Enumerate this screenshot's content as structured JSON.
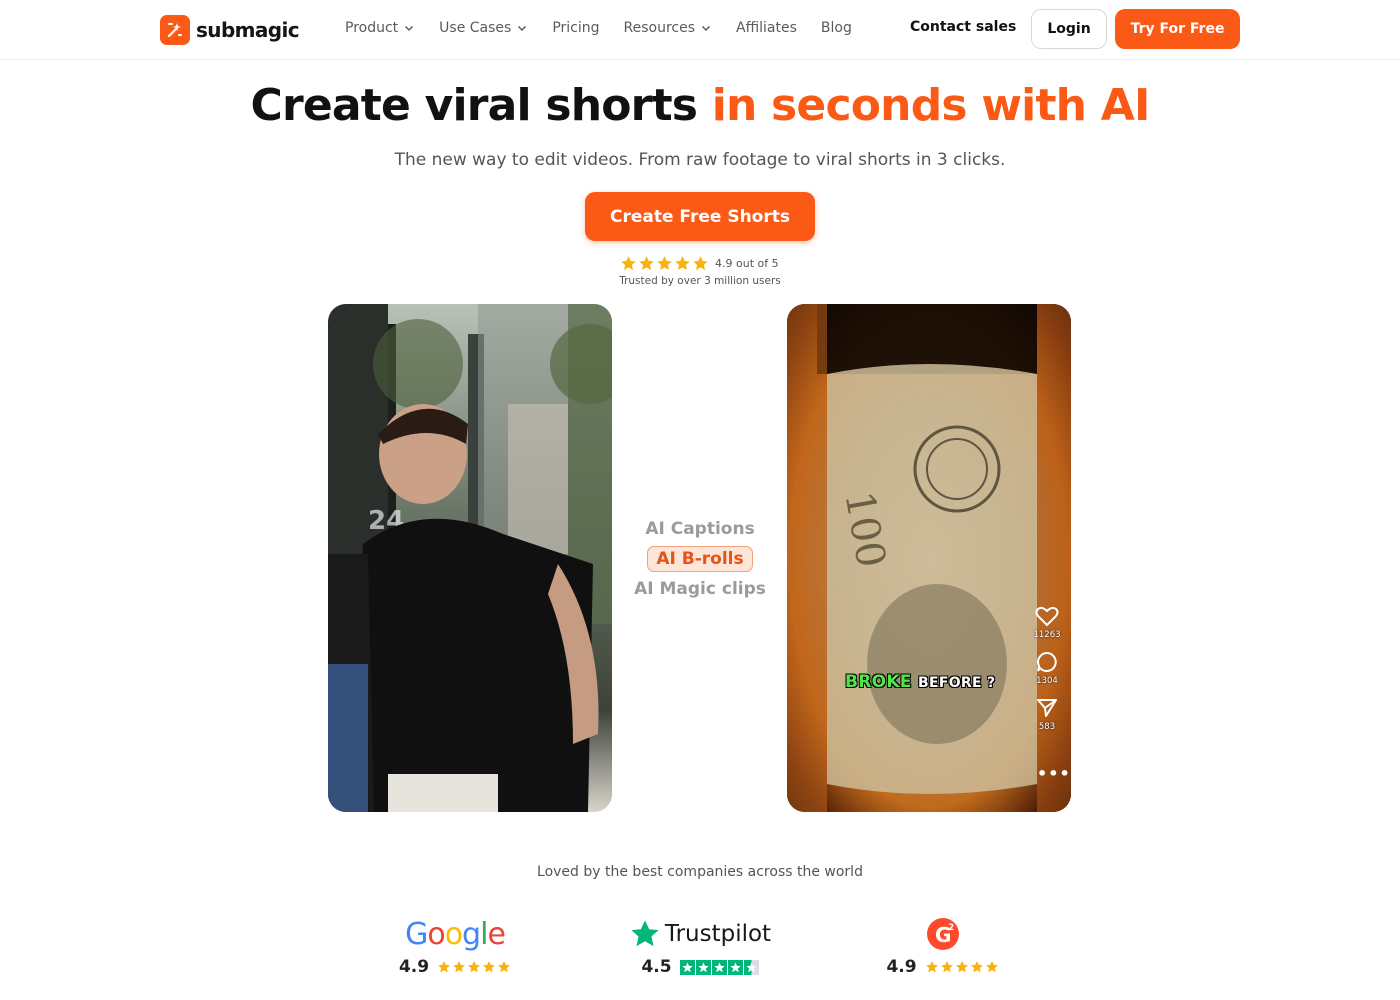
{
  "nav": {
    "brand": "submagic",
    "links": [
      {
        "label": "Product",
        "has_dropdown": true
      },
      {
        "label": "Use Cases",
        "has_dropdown": true
      },
      {
        "label": "Pricing",
        "has_dropdown": false
      },
      {
        "label": "Resources",
        "has_dropdown": true
      },
      {
        "label": "Affiliates",
        "has_dropdown": false
      },
      {
        "label": "Blog",
        "has_dropdown": false
      }
    ],
    "contact_label": "Contact sales",
    "login_label": "Login",
    "try_label": "Try For Free"
  },
  "hero": {
    "headline_plain": "Create viral shorts ",
    "headline_accent": "in seconds with AI",
    "subhead": "The new way to edit videos. From raw footage to viral shorts in 3 clicks.",
    "cta_label": "Create Free Shorts",
    "rating_value": 5,
    "rating_text": "4.9 out of 5",
    "trusted_text": "Trusted by over 3 million users"
  },
  "features": {
    "items": [
      "AI Captions",
      "AI B-rolls",
      "AI Magic clips"
    ],
    "active": "AI B-rolls"
  },
  "video_right": {
    "caption_word1": "BROKE",
    "caption_word2": "BEFORE ?",
    "likes": "11263",
    "comments": "1304",
    "shares": "583"
  },
  "social": {
    "loved_text": "Loved by the best companies across the world",
    "reviews": [
      {
        "platform": "Google",
        "score": "4.9",
        "stars": 5
      },
      {
        "platform": "Trustpilot",
        "score": "4.5",
        "stars": 4.5
      },
      {
        "platform": "G2",
        "score": "4.9",
        "stars": 5
      }
    ]
  },
  "colors": {
    "accent": "#fb5a16",
    "star": "#fbb30b",
    "trustpilot_green": "#00b67a",
    "caption_green": "#4fe64a"
  }
}
